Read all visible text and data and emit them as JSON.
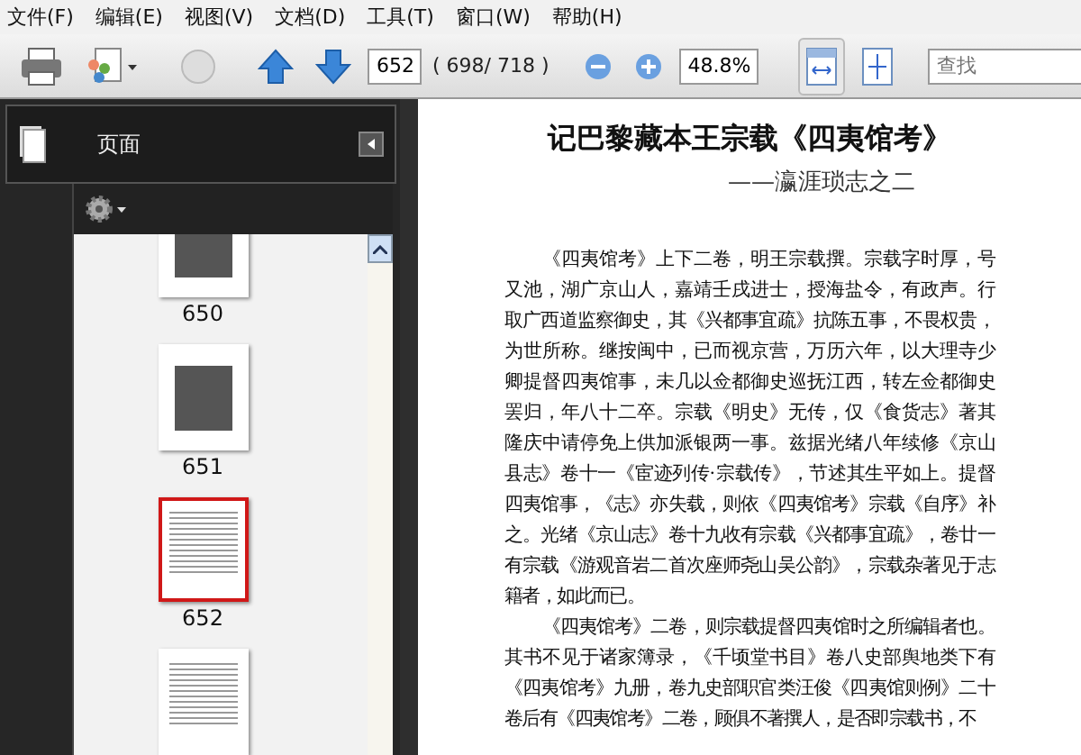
{
  "menu": [
    "文件(F)",
    "编辑(E)",
    "视图(V)",
    "文档(D)",
    "工具(T)",
    "窗口(W)",
    "帮助(H)"
  ],
  "toolbar": {
    "page_field": "652",
    "page_count": "( 698/ 718 )",
    "zoom_field": "48.8%",
    "fit_width_selected": true,
    "search": {
      "placeholder": "查找"
    }
  },
  "sidebar": {
    "title": "页面",
    "thumbnails": [
      {
        "label": "650",
        "selected": false,
        "kind": "photo"
      },
      {
        "label": "651",
        "selected": false,
        "kind": "photo"
      },
      {
        "label": "652",
        "selected": true,
        "kind": "text"
      },
      {
        "selected": false,
        "kind": "text"
      }
    ]
  },
  "document": {
    "title": "记巴黎藏本王宗载《四夷馆考》",
    "subtitle": "——瀛涯琐志之二",
    "paragraphs": [
      {
        "lines": [
          "《四夷馆考》上下二卷，明王宗载撰。宗载字时厚，号",
          "又池，湖广京山人，嘉靖壬戌进士，授海盐令，有政声。行",
          "取广西道监察御史，其《兴都事宜疏》抗陈五事，不畏权贵，",
          "为世所称。继按闽中，已而视京营，万历六年，以大理寺少",
          "卿提督四夷馆事，未几以佥都御史巡抚江西，转左佥都御史",
          "罢归，年八十二卒。宗载《明史》无传，仅《食货志》著其",
          "隆庆中请停免上供加派银两一事。兹据光绪八年续修《京山",
          "县志》卷十一《宦迹列传·宗载传》，节述其生平如上。提督",
          "四夷馆事，《志》亦失载，则依《四夷馆考》宗载《自序》补",
          "之。光绪《京山志》卷十九收有宗载《兴都事宜疏》，卷廿一",
          "有宗载《游观音岩二首次座师尧山吴公韵》，宗载杂著见于志",
          "籍者，如此而已。"
        ]
      },
      {
        "lines": [
          "《四夷馆考》二卷，则宗载提督四夷馆时之所编辑者也。",
          "其书不见于诸家簿录，《千顷堂书目》卷八史部舆地类下有",
          "《四夷馆考》九册，卷九史部职官类汪俊《四夷馆则例》二十",
          "卷后有《四夷馆考》二卷，顾俱不著撰人，是否即宗载书，不"
        ]
      }
    ]
  }
}
